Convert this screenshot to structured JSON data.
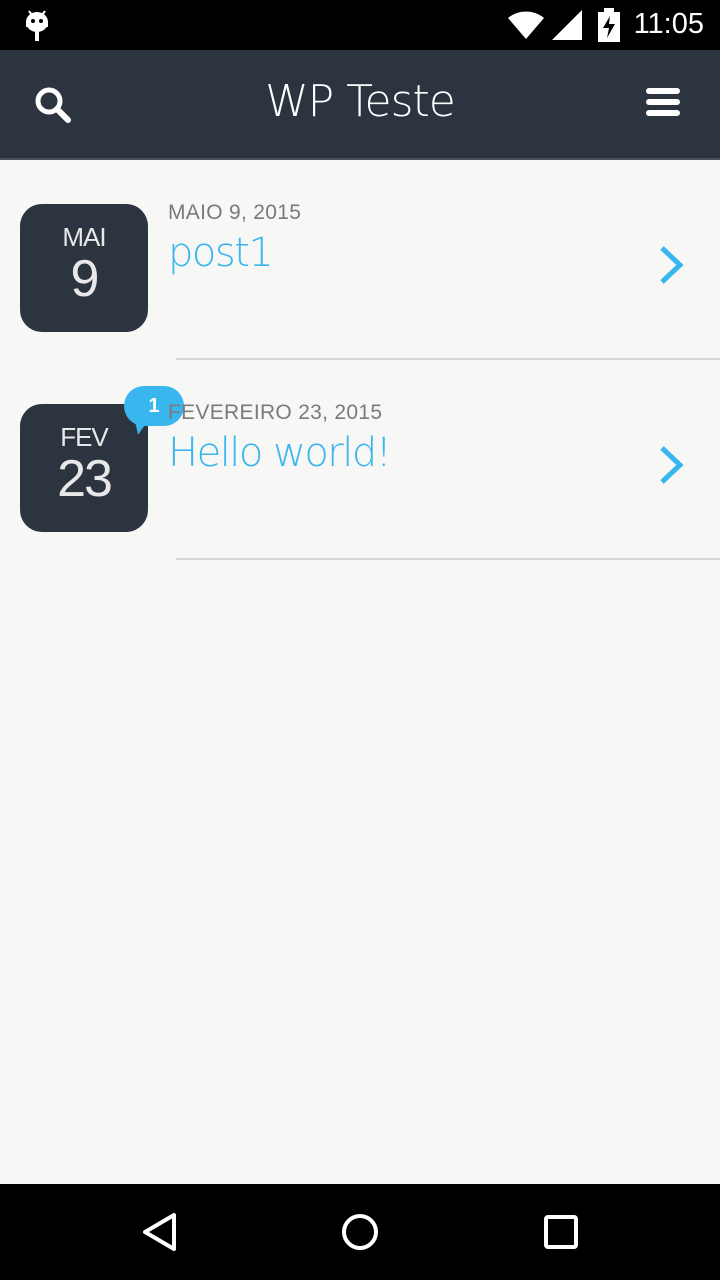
{
  "status_bar": {
    "time": "11:05",
    "icons": [
      "android-icon",
      "wifi-icon",
      "signal-icon",
      "battery-charging-icon"
    ]
  },
  "app_bar": {
    "title": "WP Teste",
    "left_icon": "search-icon",
    "right_icon": "menu-icon"
  },
  "posts": [
    {
      "month_short": "MAI",
      "day": "9",
      "date": "MAIO 9, 2015",
      "title": "post1",
      "comment_count": null
    },
    {
      "month_short": "FEV",
      "day": "23",
      "date": "FEVEREIRO 23, 2015",
      "title": "Hello world!",
      "comment_count": "1"
    }
  ],
  "nav_bar": {
    "buttons": [
      "back-icon",
      "home-icon",
      "recents-icon"
    ]
  },
  "colors": {
    "app_bar": "#2c3440",
    "accent": "#3ab6ee",
    "background": "#f7f7f5",
    "date_text": "#7a7a7a"
  }
}
